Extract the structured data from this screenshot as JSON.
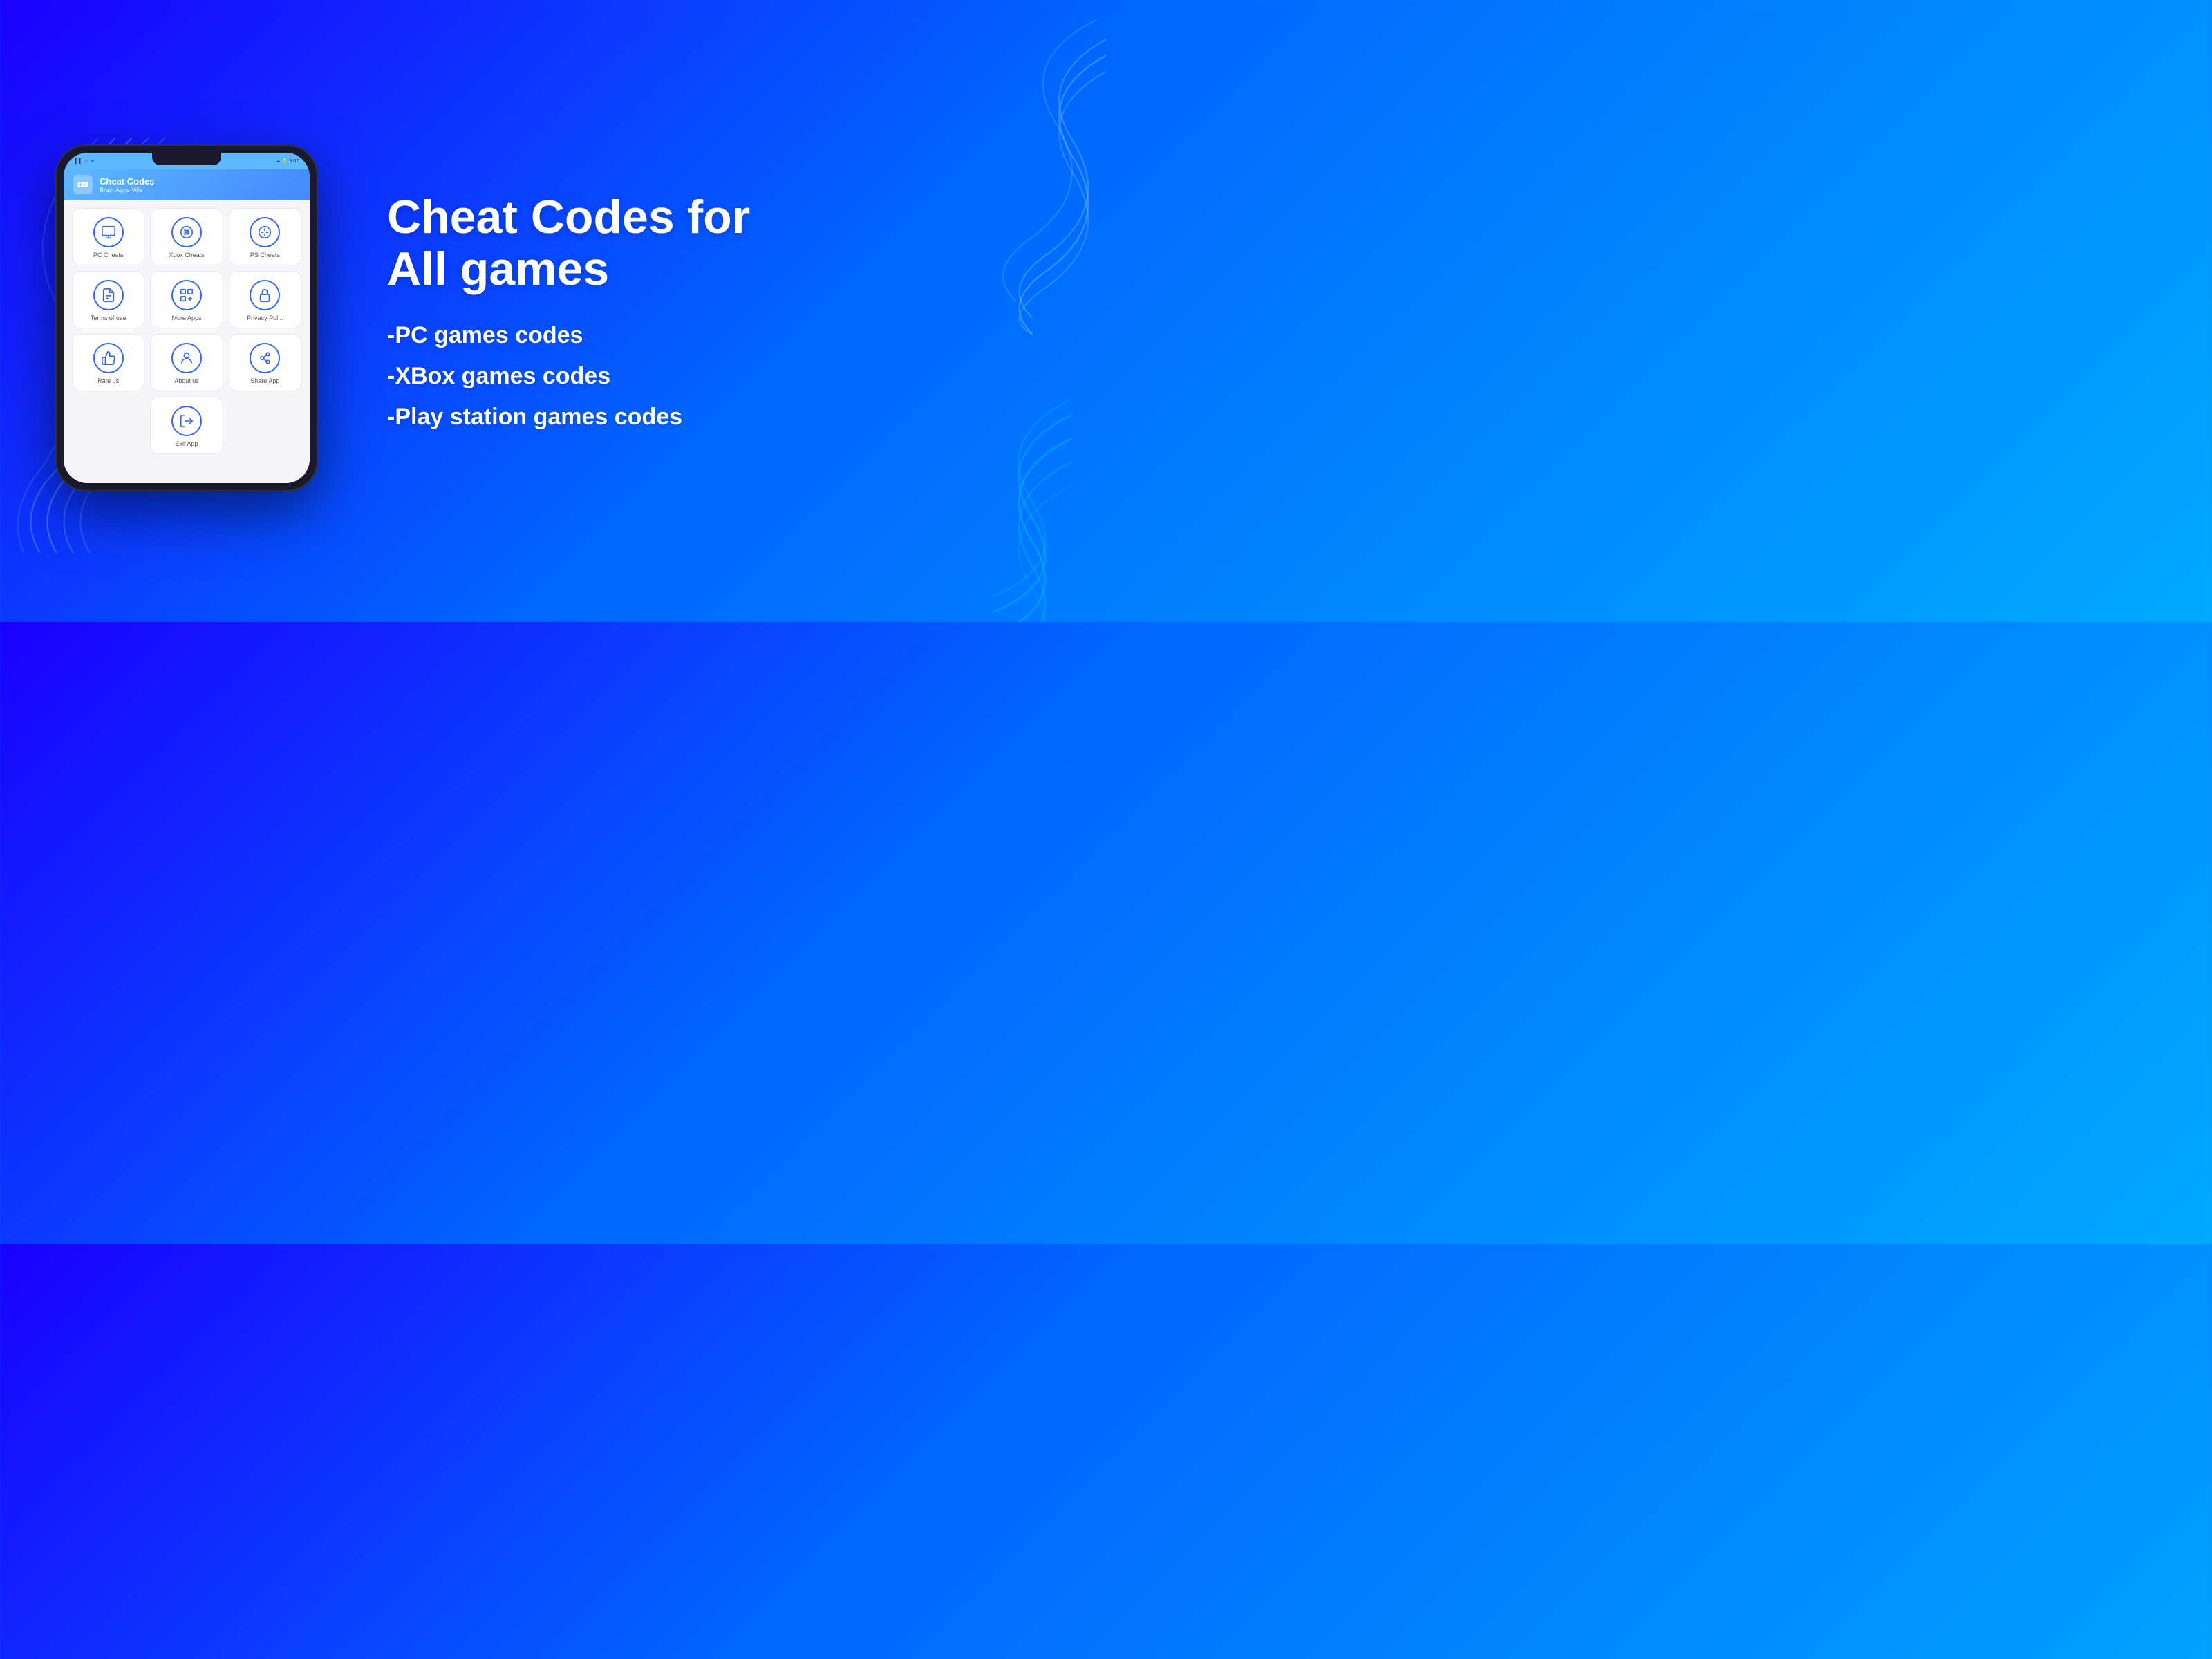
{
  "background": {
    "gradient_start": "#1a00ff",
    "gradient_end": "#00aaff"
  },
  "phone": {
    "status_bar": {
      "left_icons": "▌▌ ⌂ ≋",
      "right_icons": "☁ 🔋 9:07"
    },
    "app_header": {
      "icon": "🎮",
      "title": "Cheat Codes",
      "subtitle": "Brain Apps Ville"
    },
    "menu_items": [
      {
        "id": "pc-cheats",
        "label": "PC Cheats",
        "icon": "💻"
      },
      {
        "id": "xbox-cheats",
        "label": "Xbox Cheats",
        "icon": "🎮"
      },
      {
        "id": "ps-cheats",
        "label": "PS Cheats",
        "icon": "🕹"
      },
      {
        "id": "terms-of-use",
        "label": "Terms of use",
        "icon": "📄"
      },
      {
        "id": "more-apps",
        "label": "More Apps",
        "icon": "⊞"
      },
      {
        "id": "privacy-pol",
        "label": "Privacy Pol...",
        "icon": "🔒"
      },
      {
        "id": "rate-us",
        "label": "Rate us",
        "icon": "👍"
      },
      {
        "id": "about-us",
        "label": "About us",
        "icon": "👤"
      },
      {
        "id": "share-app",
        "label": "Share App",
        "icon": "👥"
      },
      {
        "id": "exit-app",
        "label": "Exit App",
        "icon": "🚪"
      }
    ]
  },
  "headline": {
    "line1": "Cheat Codes for",
    "line2": "All games"
  },
  "features": [
    {
      "id": "pc-feature",
      "text": "-PC games codes"
    },
    {
      "id": "xbox-feature",
      "text": "-XBox games codes"
    },
    {
      "id": "ps-feature",
      "text": "-Play station games codes"
    }
  ]
}
